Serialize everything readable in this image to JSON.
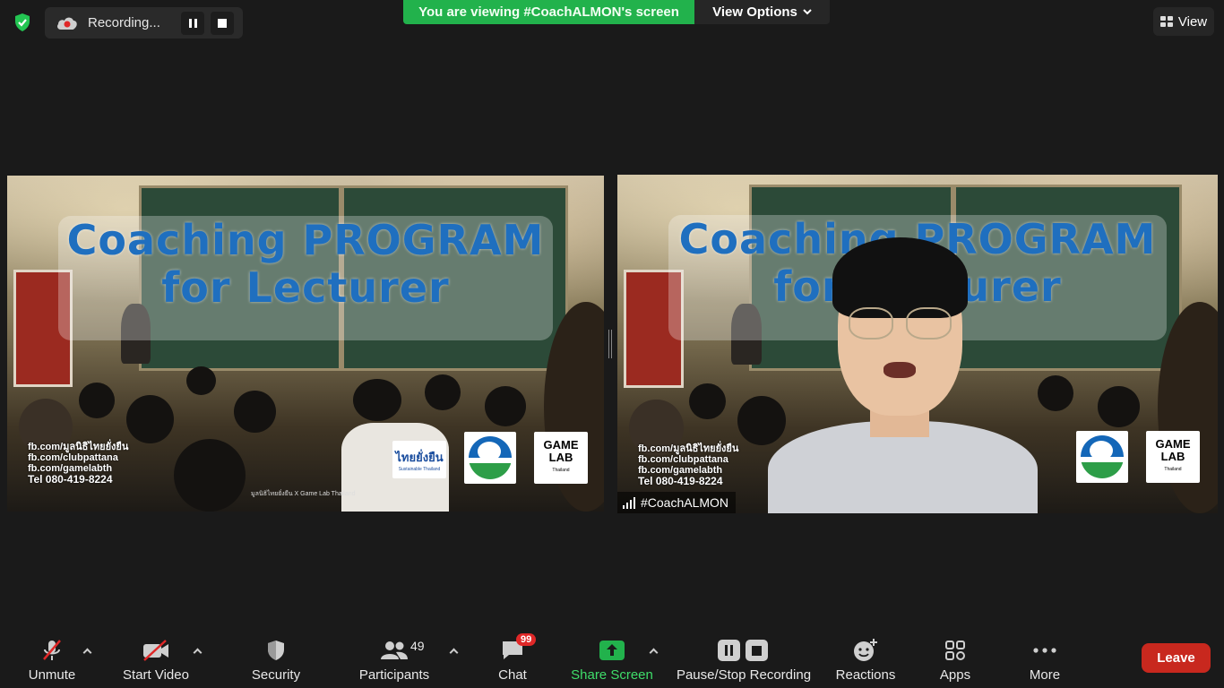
{
  "topbar": {
    "recording_label": "Recording...",
    "viewing_banner": "You are viewing #CoachALMON's screen",
    "view_options_label": "View Options",
    "view_label": "View"
  },
  "slide": {
    "title_line1": "Coaching PROGRAM",
    "title_line2": "for Lecturer",
    "contacts": [
      "fb.com/มูลนิธิไทยยั่งยืน",
      "fb.com/clubpattana",
      "fb.com/gamelabth",
      "Tel 080-419-8224"
    ],
    "logo_thai": "ไทยยั่งยืน",
    "logo_thai_sub": "Sustainable Thailand",
    "logo_game_line1": "GAME",
    "logo_game_line2": "LAB",
    "logo_game_sub": "Thailand",
    "footer_note": "มูลนิธิไทยยั่งยืน X Game Lab Thailand"
  },
  "participant": {
    "name": "#CoachALMON"
  },
  "toolbar": {
    "unmute": "Unmute",
    "start_video": "Start Video",
    "security": "Security",
    "participants": "Participants",
    "participants_count": "49",
    "chat": "Chat",
    "chat_badge": "99",
    "share_screen": "Share Screen",
    "pause_stop_recording": "Pause/Stop Recording",
    "reactions": "Reactions",
    "apps": "Apps",
    "more": "More",
    "leave": "Leave"
  },
  "colors": {
    "share_green": "#22b24c",
    "leave_red": "#c8281e",
    "slide_title_blue": "#1f6fbf"
  }
}
